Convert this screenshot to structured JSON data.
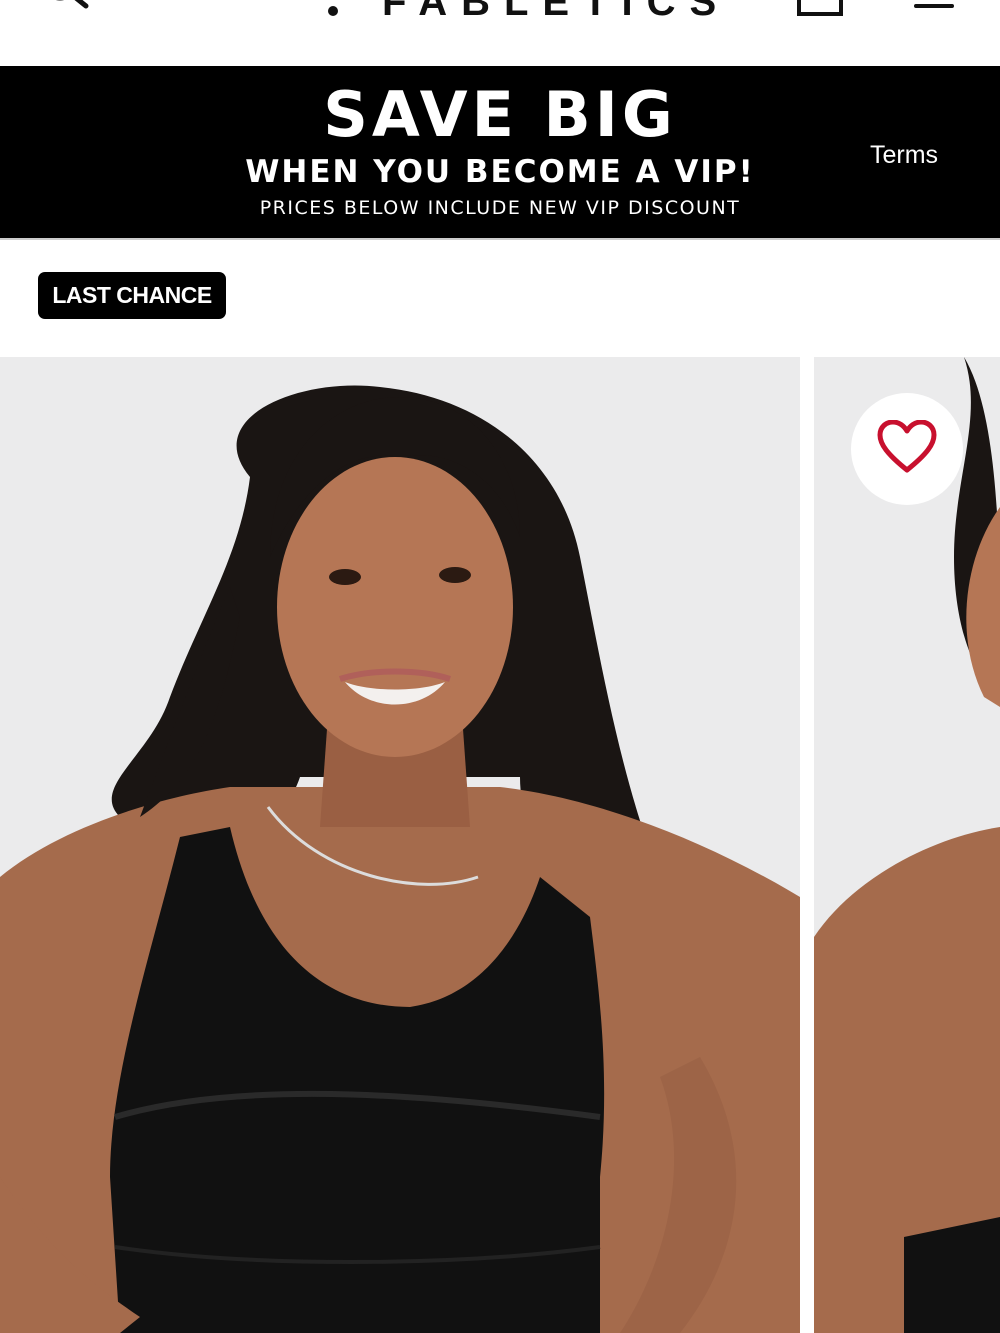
{
  "header": {
    "logo_text": "FABLETICS",
    "icons": [
      "search-icon",
      "bag-icon",
      "menu-icon"
    ]
  },
  "banner": {
    "headline": "SAVE BIG",
    "subheadline": "WHEN YOU BECOME A VIP!",
    "note": "PRICES BELOW INCLUDE NEW VIP DISCOUNT",
    "terms_label": "Terms"
  },
  "product": {
    "badge": "LAST CHANCE",
    "wishlist_icon": "heart-icon"
  },
  "colors": {
    "banner_bg": "#000000",
    "banner_text": "#ffffff",
    "badge_bg": "#000000",
    "heart": "#c8102e",
    "image_bg": "#ebebec"
  }
}
